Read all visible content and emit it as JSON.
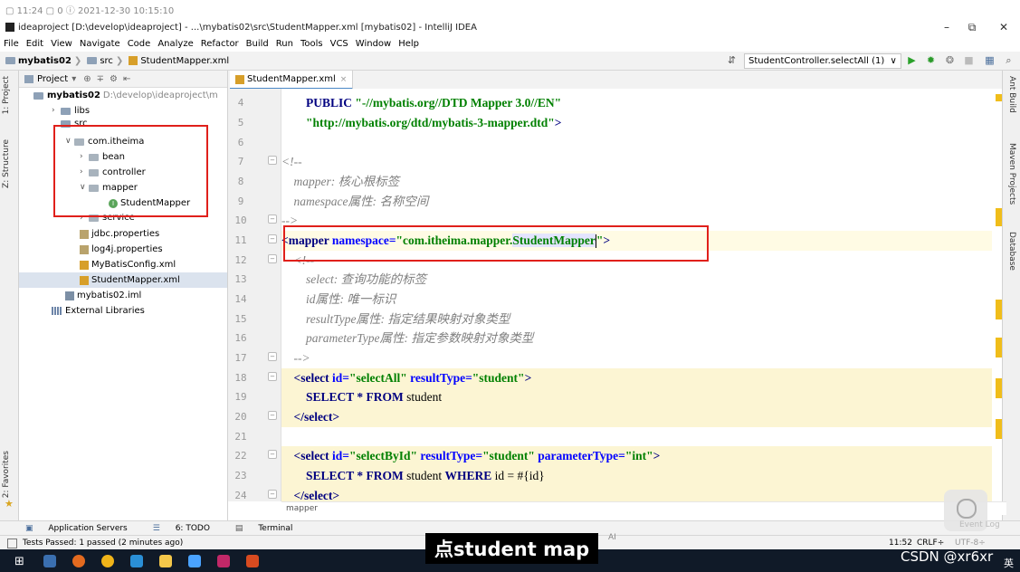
{
  "top_strip": {
    "text": "▢ 11:24  ▢ 0  ⓘ 2021-12-30 10:15:10"
  },
  "window": {
    "title": "ideaproject [D:\\develop\\ideaproject] - ...\\mybatis02\\src\\StudentMapper.xml [mybatis02] - IntelliJ IDEA",
    "minimize": "–",
    "restore": "⧉",
    "close": "✕"
  },
  "menu": [
    "File",
    "Edit",
    "View",
    "Navigate",
    "Code",
    "Analyze",
    "Refactor",
    "Build",
    "Run",
    "Tools",
    "VCS",
    "Window",
    "Help"
  ],
  "nav": {
    "crumbs": [
      "mybatis02",
      "src",
      "StudentMapper.xml"
    ],
    "run_config": "StudentController.selectAll (1)",
    "run_config_arrow": "∨"
  },
  "left_tabs": {
    "project": "1: Project",
    "structure": "Z: Structure",
    "favorites": "2: Favorites"
  },
  "right_tabs": {
    "ant": "Ant Build",
    "maven": "Maven Projects",
    "database": "Database"
  },
  "project_panel": {
    "header": "Project",
    "tree": [
      {
        "label": "mybatis02",
        "path": "D:\\develop\\ideaproject\\m"
      },
      {
        "label": "libs"
      },
      {
        "label": "src"
      },
      {
        "label": "com.itheima"
      },
      {
        "label": "bean"
      },
      {
        "label": "controller"
      },
      {
        "label": "mapper"
      },
      {
        "label": "StudentMapper"
      },
      {
        "label": "service"
      },
      {
        "label": "jdbc.properties"
      },
      {
        "label": "log4j.properties"
      },
      {
        "label": "MyBatisConfig.xml"
      },
      {
        "label": "StudentMapper.xml"
      },
      {
        "label": "mybatis02.iml"
      },
      {
        "label": "External Libraries"
      }
    ]
  },
  "editor": {
    "tab": "StudentMapper.xml",
    "tab_close": "×",
    "line_numbers": [
      "4",
      "5",
      "6",
      "7",
      "8",
      "9",
      "10",
      "11",
      "12",
      "13",
      "14",
      "15",
      "16",
      "17",
      "18",
      "19",
      "20",
      "21",
      "22",
      "23",
      "24"
    ],
    "lines": {
      "l4a": "PUBLIC ",
      "l4b": "\"-//mybatis.org//DTD Mapper 3.0//EN\"",
      "l5": "\"http://mybatis.org/dtd/mybatis-3-mapper.dtd\"",
      "l5b": ">",
      "l7": "<!--",
      "l8": "mapper: 核心根标签",
      "l9": "namespace属性: 名称空间",
      "l10": "-->",
      "l11a": "<mapper ",
      "l11b": "namespace=",
      "l11c": "\"com.itheima.mapper.",
      "l11d": "StudentMapper",
      "l11e": "\"",
      "l11f": ">",
      "l12": "<!--",
      "l13": "select: 查询功能的标签",
      "l14": "id属性: 唯一标识",
      "l15": "resultType属性: 指定结果映射对象类型",
      "l16": "parameterType属性: 指定参数映射对象类型",
      "l17": "-->",
      "l18a": "<select ",
      "l18b": "id=",
      "l18c": "\"selectAll\"",
      "l18d": " resultType=",
      "l18e": "\"student\"",
      "l18f": ">",
      "l19a": "SELECT ",
      "l19b": "* FROM ",
      "l19c": "student",
      "l20": "</select>",
      "l22a": "<select ",
      "l22b": "id=",
      "l22c": "\"selectById\"",
      "l22d": " resultType=",
      "l22e": "\"student\"",
      "l22f": " parameterType=",
      "l22g": "\"int\"",
      "l22h": ">",
      "l23a": "SELECT ",
      "l23b": "* FROM ",
      "l23c": "student ",
      "l23d": "WHERE ",
      "l23e": "id = #{id}",
      "l24": "</select>"
    },
    "breadcrumb_footer": "mapper"
  },
  "tool_windows": [
    "Application Servers",
    "6: TODO",
    "Terminal"
  ],
  "status": {
    "left": "Tests Passed: 1 passed (2 minutes ago)",
    "position": "11:52",
    "line_sep": "CRLF÷",
    "encoding": "UTF-8÷",
    "event_log": "Event Log"
  },
  "overlay": {
    "subtitle": "点student map",
    "ai_badge": "AI",
    "watermark": "CSDN @xr6xr",
    "ime": "英"
  },
  "colors": {
    "highlight_box": "#e0201b",
    "yellow_band": "#fcf5d3",
    "scroll_mark": "#f0bd1a"
  }
}
